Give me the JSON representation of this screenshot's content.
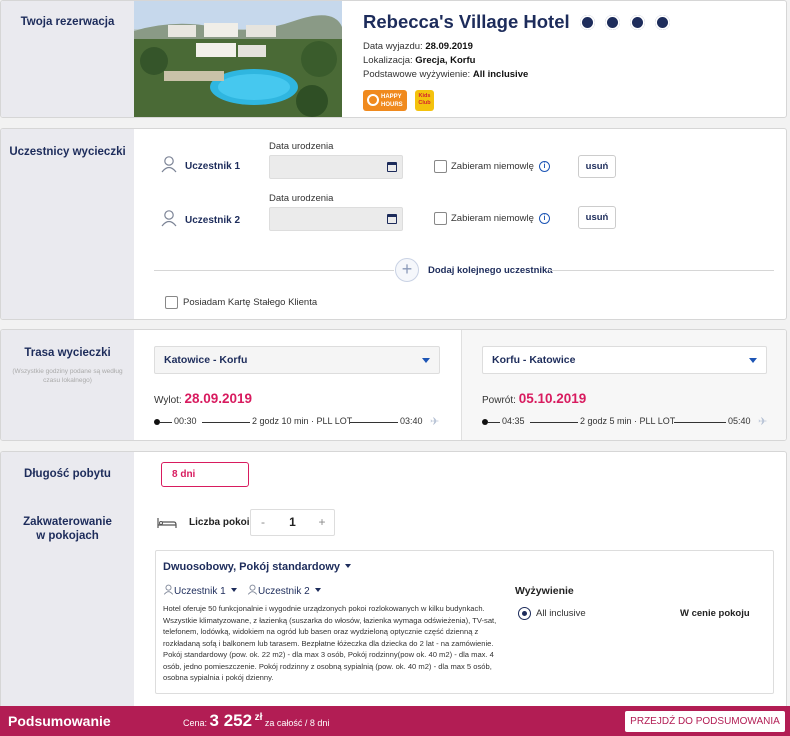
{
  "reservation": {
    "section_title": "Twoja rezerwacja",
    "hotel_name": "Rebecca's Village Hotel",
    "stars": 4,
    "departure_label": "Data wyjazdu:",
    "departure_value": "28.09.2019",
    "location_label": "Lokalizacja:",
    "location_value": "Grecja, Korfu",
    "board_label": "Podstawowe wyżywienie:",
    "board_value": "All inclusive",
    "badge_happy_line1": "HAPPY",
    "badge_happy_line2": "HOURS",
    "badge_kids": "Kids Club"
  },
  "participants": {
    "section_title": "Uczestnicy wycieczki",
    "items": [
      {
        "name": "Uczestnik 1",
        "dob_label": "Data urodzenia",
        "dob_value": "",
        "infant_label": "Zabieram niemowlę",
        "remove_label": "usuń"
      },
      {
        "name": "Uczestnik 2",
        "dob_label": "Data urodzenia",
        "dob_value": "",
        "infant_label": "Zabieram niemowlę",
        "remove_label": "usuń"
      }
    ],
    "add_label": "Dodaj kolejnego uczestnika",
    "loyalty_label": "Posiadam Kartę Stałego Klienta"
  },
  "route": {
    "section_title": "Trasa wycieczki",
    "note": "(Wszystkie godziny podane są według czasu lokalnego)",
    "outbound": {
      "select": "Katowice - Korfu",
      "date_label": "Wylot:",
      "date": "28.09.2019",
      "dep_time": "00:30",
      "duration": "2 godz 10 min",
      "carrier": "PLL LOT",
      "arr_time": "03:40"
    },
    "return": {
      "select": "Korfu - Katowice",
      "date_label": "Powrót:",
      "date": "05.10.2019",
      "dep_time": "04:35",
      "duration": "2 godz 5 min",
      "carrier": "PLL LOT",
      "arr_time": "05:40"
    }
  },
  "stay": {
    "length_title": "Długość pobytu",
    "length_value": "8 dni",
    "rooms_title": "Zakwaterowanie w pokojach",
    "rooms_label": "Liczba pokoi",
    "rooms_minus": "-",
    "rooms_count": "1",
    "rooms_plus": "+",
    "room": {
      "type": "Dwuosobowy, Pokój standardowy",
      "person1": "Uczestnik 1",
      "person2": "Uczestnik 2",
      "description": "Hotel oferuje 50 funkcjonalnie i wygodnie urządzonych pokoi rozlokowanych w kilku budynkach. Wszystkie klimatyzowane, z łazienką (suszarka do włosów, łazienka wymaga odświeżenia), TV-sat, telefonem, lodówką, widokiem na ogród lub basen oraz wydzieloną optycznie część dzienną z rozkładaną sofą i balkonem lub tarasem. Bezpłatne łóżeczka dla dziecka do 2 lat - na zamówienie. Pokój standardowy (pow. ok. 22 m2) - dla max 3 osób, Pokój rodzinny(pow ok. 40 m2) - dla max. 4 osób, jedno pomieszczenie. Pokój rodzinny z osobną sypialnią (pow. ok. 40 m2) - dla max 5 osób, osobna sypialnia i pokój dzienny.",
      "board_title": "Wyżywienie",
      "board_option": "All inclusive",
      "board_price": "W cenie pokoju"
    }
  },
  "footer": {
    "title": "Podsumowanie",
    "price_label": "Cena:",
    "price_amount": "3 252",
    "currency": "zł",
    "price_suffix": "za całość / 8 dni",
    "button": "PRZEJDŹ DO PODSUMOWANIA"
  },
  "colors": {
    "navy": "#1d2c5b",
    "accent": "#d81b5f",
    "footer": "#b21d54",
    "sidebar": "#eaeaef"
  }
}
